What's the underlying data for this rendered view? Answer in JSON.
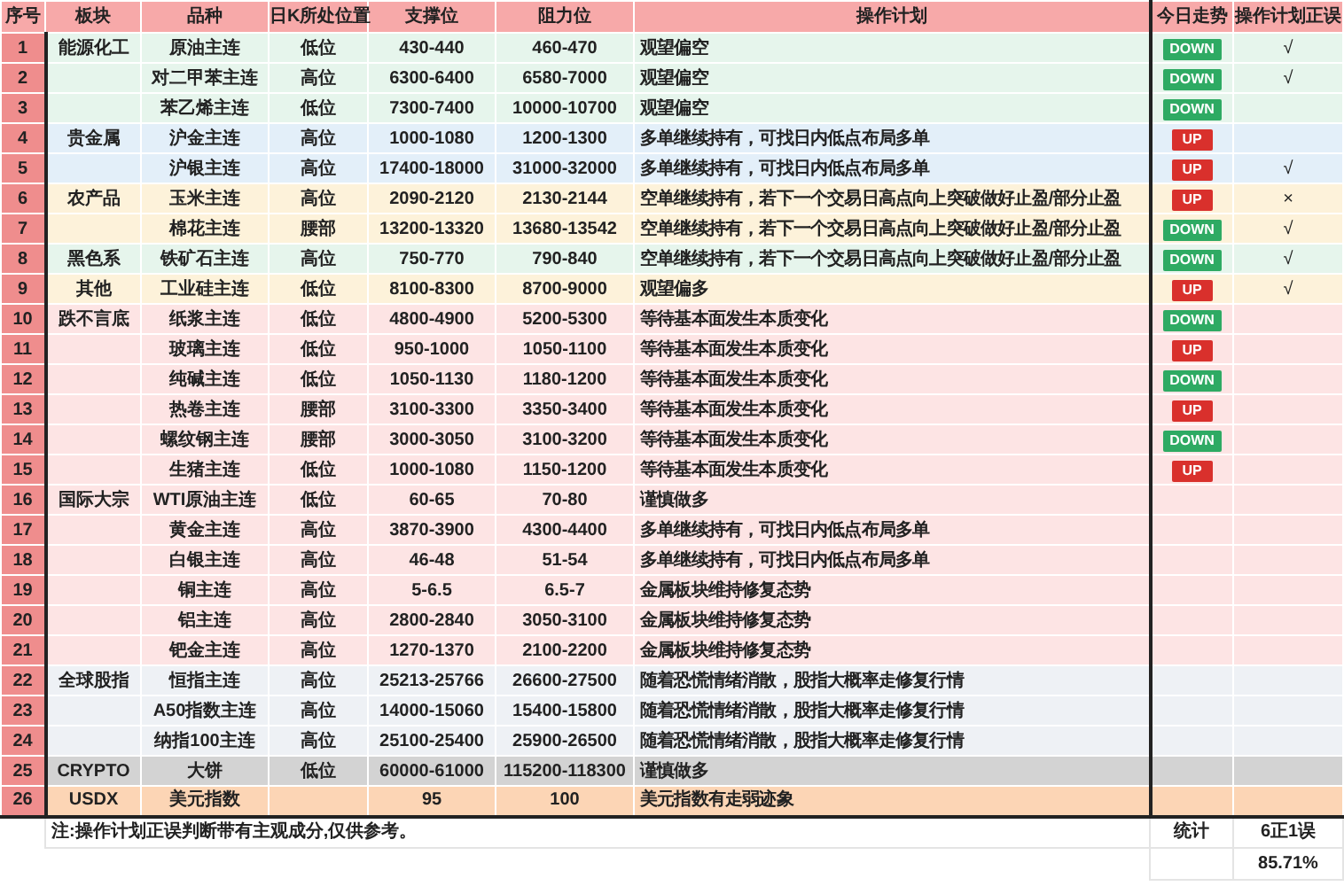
{
  "columns": [
    "序号",
    "板块",
    "品种",
    "日K所处位置",
    "支撑位",
    "阻力位",
    "操作计划",
    "今日走势",
    "操作计划正误"
  ],
  "rows": [
    {
      "index": "1",
      "sector": "能源化工",
      "name": "原油主连",
      "position": "低位",
      "support": "430-440",
      "resistance": "460-470",
      "plan": "观望偏空",
      "trend": {
        "kind": "down",
        "label": "DOWN"
      },
      "correct": "√",
      "color": "#e6f5ec"
    },
    {
      "index": "2",
      "name": "对二甲苯主连",
      "position": "高位",
      "support": "6300-6400",
      "resistance": "6580-7000",
      "plan": "观望偏空",
      "trend": {
        "kind": "down",
        "label": "DOWN"
      },
      "correct": "√",
      "color": "#e6f5ec"
    },
    {
      "index": "3",
      "name": "苯乙烯主连",
      "position": "低位",
      "support": "7300-7400",
      "resistance": "10000-10700",
      "plan": "观望偏空",
      "trend": {
        "kind": "down",
        "label": "DOWN"
      },
      "color": "#e6f5ec"
    },
    {
      "index": "4",
      "sector": "贵金属",
      "name": "沪金主连",
      "position": "高位",
      "support": "1000-1080",
      "resistance": "1200-1300",
      "plan": "多单继续持有，可找日内低点布局多单",
      "trend": {
        "kind": "up",
        "label": "UP"
      },
      "color": "#e3eff9"
    },
    {
      "index": "5",
      "name": "沪银主连",
      "position": "高位",
      "support": "17400-18000",
      "resistance": "31000-32000",
      "plan": "多单继续持有，可找日内低点布局多单",
      "trend": {
        "kind": "up",
        "label": "UP"
      },
      "correct": "√",
      "color": "#e3eff9"
    },
    {
      "index": "6",
      "sector": "农产品",
      "name": "玉米主连",
      "position": "高位",
      "support": "2090-2120",
      "resistance": "2130-2144",
      "plan": "空单继续持有，若下一个交易日高点向上突破做好止盈/部分止盈",
      "trend": {
        "kind": "up",
        "label": "UP"
      },
      "correct": "×",
      "color": "#fdf2da"
    },
    {
      "index": "7",
      "name": "棉花主连",
      "position": "腰部",
      "support": "13200-13320",
      "resistance": "13680-13542",
      "plan": "空单继续持有，若下一个交易日高点向上突破做好止盈/部分止盈",
      "trend": {
        "kind": "down",
        "label": "DOWN"
      },
      "correct": "√",
      "color": "#fdf2da"
    },
    {
      "index": "8",
      "sector": "黑色系",
      "name": "铁矿石主连",
      "position": "高位",
      "support": "750-770",
      "resistance": "790-840",
      "plan": "空单继续持有，若下一个交易日高点向上突破做好止盈/部分止盈",
      "trend": {
        "kind": "down",
        "label": "DOWN"
      },
      "correct": "√",
      "color": "#e6f5ec"
    },
    {
      "index": "9",
      "sector": "其他",
      "name": "工业硅主连",
      "position": "低位",
      "support": "8100-8300",
      "resistance": "8700-9000",
      "plan": "观望偏多",
      "trend": {
        "kind": "up",
        "label": "UP"
      },
      "correct": "√",
      "color": "#fdf2da"
    },
    {
      "index": "10",
      "sector": "跌不言底",
      "name": "纸浆主连",
      "position": "低位",
      "support": "4800-4900",
      "resistance": "5200-5300",
      "plan": "等待基本面发生本质变化",
      "trend": {
        "kind": "down",
        "label": "DOWN"
      },
      "color": "#fde4e4"
    },
    {
      "index": "11",
      "name": "玻璃主连",
      "position": "低位",
      "support": "950-1000",
      "resistance": "1050-1100",
      "plan": "等待基本面发生本质变化",
      "trend": {
        "kind": "up",
        "label": "UP"
      },
      "color": "#fde4e4"
    },
    {
      "index": "12",
      "name": "纯碱主连",
      "position": "低位",
      "support": "1050-1130",
      "resistance": "1180-1200",
      "plan": "等待基本面发生本质变化",
      "trend": {
        "kind": "down",
        "label": "DOWN"
      },
      "color": "#fde4e4"
    },
    {
      "index": "13",
      "name": "热卷主连",
      "position": "腰部",
      "support": "3100-3300",
      "resistance": "3350-3400",
      "plan": "等待基本面发生本质变化",
      "trend": {
        "kind": "up",
        "label": "UP"
      },
      "color": "#fde4e4"
    },
    {
      "index": "14",
      "name": "螺纹钢主连",
      "position": "腰部",
      "support": "3000-3050",
      "resistance": "3100-3200",
      "plan": "等待基本面发生本质变化",
      "trend": {
        "kind": "down",
        "label": "DOWN"
      },
      "color": "#fde4e4"
    },
    {
      "index": "15",
      "name": "生猪主连",
      "position": "低位",
      "support": "1000-1080",
      "resistance": "1150-1200",
      "plan": "等待基本面发生本质变化",
      "trend": {
        "kind": "up",
        "label": "UP"
      },
      "color": "#fde4e4"
    },
    {
      "index": "16",
      "sector": "国际大宗",
      "name": "WTI原油主连",
      "position": "低位",
      "support": "60-65",
      "resistance": "70-80",
      "plan": "谨慎做多",
      "color": "#fde4e4"
    },
    {
      "index": "17",
      "name": "黄金主连",
      "position": "高位",
      "support": "3870-3900",
      "resistance": "4300-4400",
      "plan": "多单继续持有，可找日内低点布局多单",
      "color": "#fde4e4"
    },
    {
      "index": "18",
      "name": "白银主连",
      "position": "高位",
      "support": "46-48",
      "resistance": "51-54",
      "plan": "多单继续持有，可找日内低点布局多单",
      "color": "#fde4e4"
    },
    {
      "index": "19",
      "name": "铜主连",
      "position": "高位",
      "support": "5-6.5",
      "resistance": "6.5-7",
      "plan": "金属板块维持修复态势",
      "color": "#fde4e4"
    },
    {
      "index": "20",
      "name": "铝主连",
      "position": "高位",
      "support": "2800-2840",
      "resistance": "3050-3100",
      "plan": "金属板块维持修复态势",
      "color": "#fde4e4"
    },
    {
      "index": "21",
      "name": "钯金主连",
      "position": "高位",
      "support": "1270-1370",
      "resistance": "2100-2200",
      "plan": "金属板块维持修复态势",
      "color": "#fde4e4"
    },
    {
      "index": "22",
      "sector": "全球股指",
      "name": "恒指主连",
      "position": "高位",
      "support": "25213-25766",
      "resistance": "26600-27500",
      "plan": "随着恐慌情绪消散，股指大概率走修复行情",
      "color": "#eef1f5"
    },
    {
      "index": "23",
      "name": "A50指数主连",
      "position": "高位",
      "support": "14000-15060",
      "resistance": "15400-15800",
      "plan": "随着恐慌情绪消散，股指大概率走修复行情",
      "color": "#eef1f5"
    },
    {
      "index": "24",
      "name": "纳指100主连",
      "position": "高位",
      "support": "25100-25400",
      "resistance": "25900-26500",
      "plan": "随着恐慌情绪消散，股指大概率走修复行情",
      "color": "#eef1f5"
    },
    {
      "index": "25",
      "sector": "CRYPTO",
      "name": "大饼",
      "position": "低位",
      "support": "60000-61000",
      "resistance": "115200-118300",
      "plan": "谨慎做多",
      "color": "#d3d3d3"
    },
    {
      "index": "26",
      "sector": "USDX",
      "name": "美元指数",
      "support": "95",
      "resistance": "100",
      "plan": "美元指数有走弱迹象",
      "color": "#fcd5b5"
    }
  ],
  "footer": {
    "note": "注:操作计划正误判断带有主观成分,仅供参考。",
    "stats_label": "统计",
    "stats_value": "6正1误",
    "accuracy": "85.71%"
  }
}
